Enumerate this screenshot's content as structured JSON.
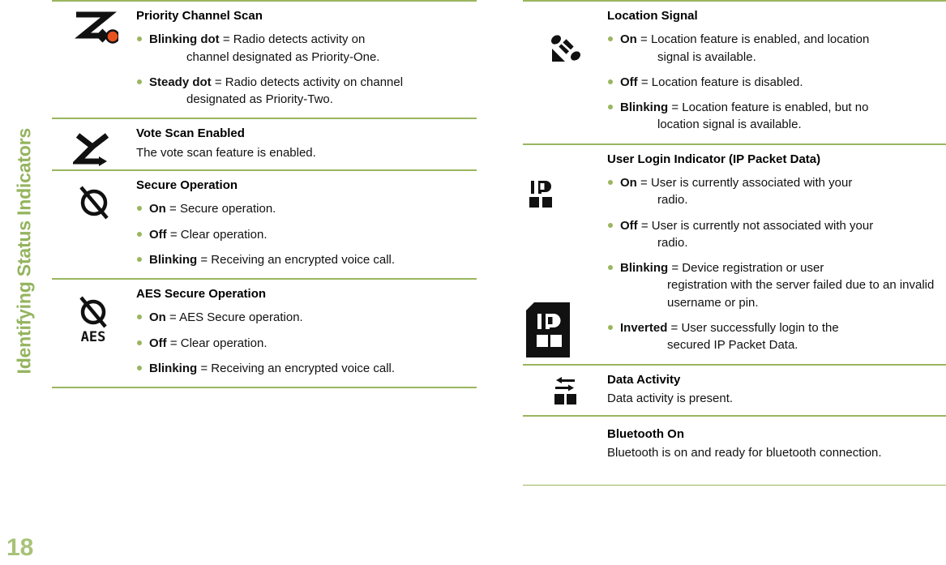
{
  "sidebar": {
    "title": "Identifying Status Indicators",
    "page_number": "18",
    "accent_color": "#9ab65f",
    "page_number_color": "#a8c277"
  },
  "colors": {
    "rule": "#9ab65f",
    "bullet": "#9ab65f",
    "icon": "#111111",
    "priority_dot": "#e8521e",
    "text": "#111111"
  },
  "left_column": {
    "entries": [
      {
        "icon": "priority-channel-scan-icon",
        "title": "Priority Channel Scan",
        "bullets": [
          {
            "label": "Blinking dot",
            "text": " = Radio detects activity on",
            "cont": "channel designated as Priority-One."
          },
          {
            "label": "Steady dot",
            "text": " = Radio detects activity on channel",
            "cont": "designated as Priority-Two."
          }
        ]
      },
      {
        "icon": "vote-scan-icon",
        "title": "Vote Scan Enabled",
        "desc": "The vote scan feature is enabled."
      },
      {
        "icon": "secure-operation-icon",
        "title": "Secure Operation",
        "bullets": [
          {
            "label": "On",
            "text": " = Secure operation."
          },
          {
            "label": "Off",
            "text": " = Clear operation."
          },
          {
            "label": "Blinking",
            "text": " = Receiving an encrypted voice call."
          }
        ]
      },
      {
        "icon": "aes-secure-operation-icon",
        "title": "AES Secure Operation",
        "bullets": [
          {
            "label": "On",
            "text": " = AES Secure operation."
          },
          {
            "label": "Off",
            "text": " = Clear operation."
          },
          {
            "label": "Blinking",
            "text": " = Receiving an encrypted voice call."
          }
        ]
      }
    ]
  },
  "right_column": {
    "entries": [
      {
        "icon": "location-signal-satellite-icon",
        "title": "Location Signal",
        "bullets": [
          {
            "label": "On",
            "text": " = Location feature is enabled, and location",
            "cont": "signal is available."
          },
          {
            "label": "Off",
            "text": " = Location feature is disabled."
          },
          {
            "label": "Blinking",
            "text": " = Location feature is enabled, but no",
            "cont": "location signal is available."
          }
        ]
      },
      {
        "icon": "ip-packet-data-icon",
        "icon_secondary": "ip-packet-data-inverted-icon",
        "title": "User Login Indicator (IP Packet Data)",
        "bullets": [
          {
            "label": "On",
            "text": " = User is currently associated with your",
            "cont": "radio."
          },
          {
            "label": "Off",
            "text": " = User is currently not associated with your",
            "cont": "radio."
          },
          {
            "label": "Blinking",
            "text": " = Device registration or user",
            "cont": "registration with the server failed due to an invalid username or pin."
          },
          {
            "label": "Inverted",
            "text": " = User successfully login to the",
            "cont": "secured IP Packet Data."
          }
        ]
      },
      {
        "icon": "data-activity-icon",
        "title": "Data Activity",
        "desc": "Data activity is present."
      },
      {
        "icon": "bluetooth-on-icon",
        "title": "Bluetooth On",
        "desc": "Bluetooth is on and ready for bluetooth connection."
      }
    ]
  }
}
